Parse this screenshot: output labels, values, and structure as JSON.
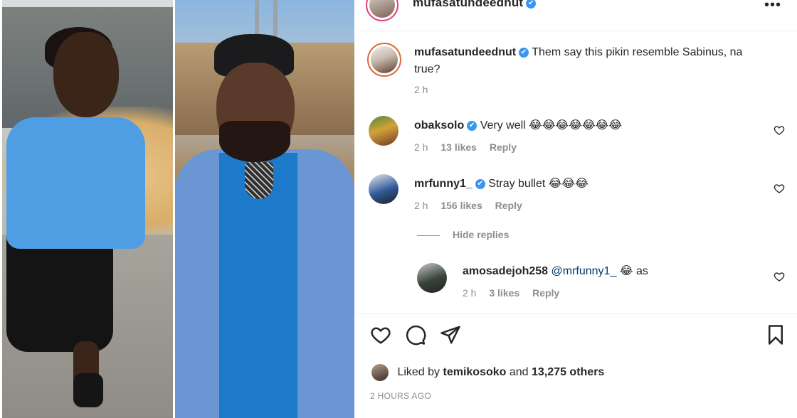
{
  "post_header": {
    "username": "mufasatundeednut",
    "verified_symbol": "✔",
    "more_symbol": "•••"
  },
  "caption": {
    "username": "mufasatundeednut",
    "text": "Them say this pikin resemble Sabinus, na true?",
    "time": "2 h"
  },
  "comments": [
    {
      "username": "obaksolo",
      "text": "Very well 😂😂😂😂😂😂😂",
      "time": "2 h",
      "likes": "13 likes",
      "reply": "Reply"
    },
    {
      "username": "mrfunny1_",
      "text": "Stray bullet 😂😂😂",
      "time": "2 h",
      "likes": "156 likes",
      "reply": "Reply"
    }
  ],
  "hide_replies": "Hide replies",
  "reply": {
    "username": "amosadejoh258",
    "mention": "@mrfunny1_",
    "text": "😂 as",
    "time": "2 h",
    "likes": "3 likes",
    "reply": "Reply"
  },
  "likes_line": {
    "prefix": "Liked by",
    "user": "temikosoko",
    "middle": "and",
    "others": "13,275 others"
  },
  "timestamp": "2 HOURS AGO",
  "colors": {
    "verified": "#3897f0",
    "muted": "#8e8e8e",
    "text": "#262626",
    "story_ring": "#e26a3a"
  }
}
